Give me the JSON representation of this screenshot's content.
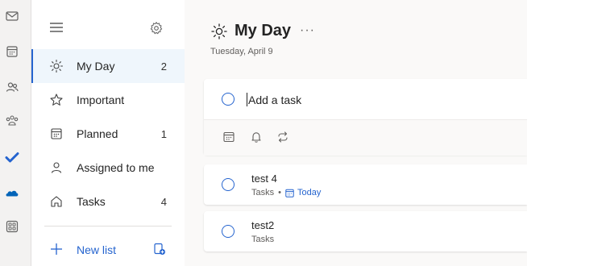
{
  "colors": {
    "accent": "#2564cf",
    "todo_check": "#2564cf",
    "onedrive": "#0364b8"
  },
  "rail": {
    "icons": [
      "mail-icon",
      "calendar-icon",
      "people-icon",
      "groups-icon",
      "todo-icon",
      "onedrive-icon",
      "apps-icon"
    ]
  },
  "sidebar": {
    "items": [
      {
        "label": "My Day",
        "count": "2",
        "icon": "sun-icon"
      },
      {
        "label": "Important",
        "count": "",
        "icon": "star-icon"
      },
      {
        "label": "Planned",
        "count": "1",
        "icon": "calendar-icon"
      },
      {
        "label": "Assigned to me",
        "count": "",
        "icon": "person-icon"
      },
      {
        "label": "Tasks",
        "count": "4",
        "icon": "home-icon"
      }
    ],
    "new_list_label": "New list"
  },
  "main": {
    "title": "My Day",
    "more_label": "···",
    "date": "Tuesday, April 9",
    "add_task": {
      "placeholder": "Add a task"
    },
    "tasks": [
      {
        "title": "test 4",
        "list": "Tasks",
        "separator": "•",
        "due": "Today"
      },
      {
        "title": "test2",
        "list": "Tasks"
      }
    ]
  }
}
